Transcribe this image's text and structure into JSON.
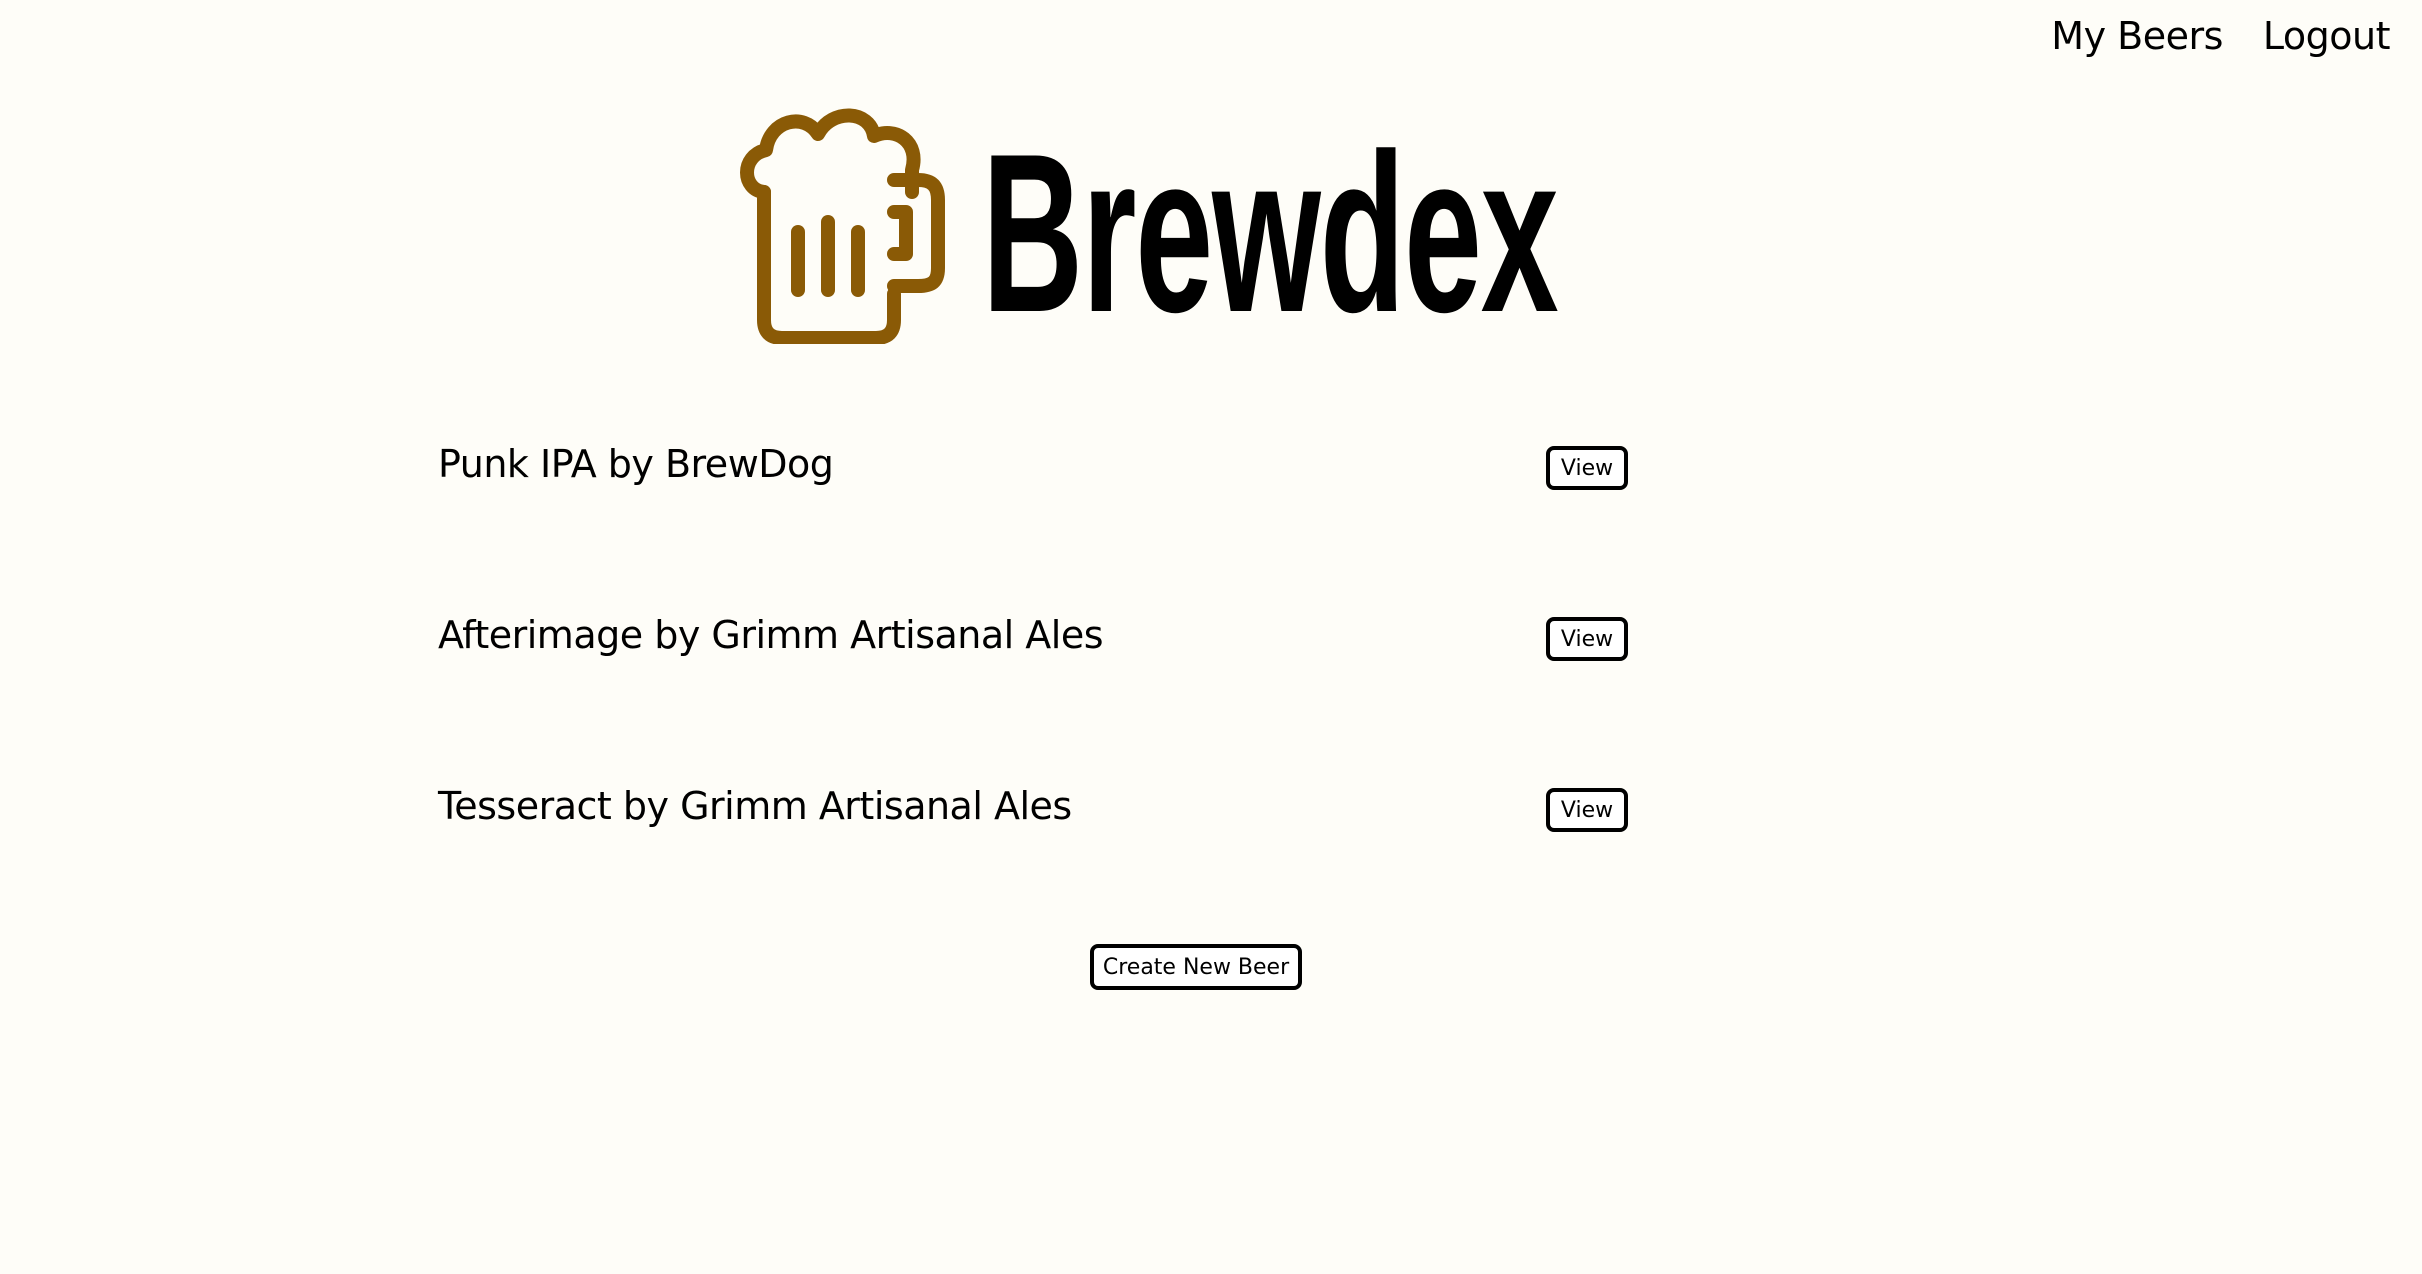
{
  "theme": {
    "background": "#FEFDF8",
    "brand_color": "#8A5A06",
    "text_color": "#000000"
  },
  "nav": {
    "my_beers": "My Beers",
    "logout": "Logout"
  },
  "logo": {
    "icon": "beer-mug-icon",
    "text": "Brewdex"
  },
  "beers": [
    {
      "name": "Punk IPA by BrewDog",
      "view_label": "View"
    },
    {
      "name": "Afterimage by Grimm Artisanal Ales",
      "view_label": "View"
    },
    {
      "name": "Tesseract by Grimm Artisanal Ales",
      "view_label": "View"
    }
  ],
  "actions": {
    "create_label": "Create New Beer"
  }
}
